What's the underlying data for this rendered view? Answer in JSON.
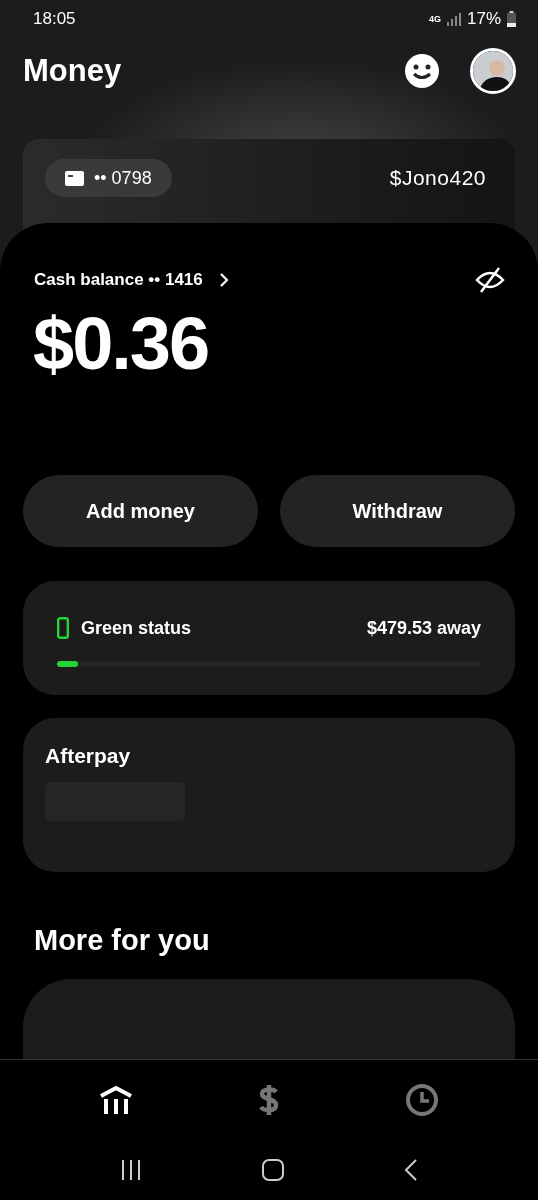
{
  "status_bar": {
    "time": "18:05",
    "network": "4G",
    "battery": "17%"
  },
  "header": {
    "title": "Money"
  },
  "card": {
    "number": "•• 0798",
    "cashtag": "$Jono420"
  },
  "balance": {
    "label": "Cash balance •• 1416",
    "amount": "$0.36",
    "hidden": false
  },
  "actions": [
    "Add money",
    "Withdraw"
  ],
  "green_status": {
    "label": "Green status",
    "reading": "$479.53 away",
    "level": 0.05
  },
  "afterpay": {
    "title": "Afterpay"
  },
  "more": {
    "title": "More for you"
  },
  "nav_tabs": [
    {
      "kind": "bank",
      "selected": true
    },
    {
      "kind": "dollar",
      "selected": false
    },
    {
      "kind": "clock",
      "selected": false
    }
  ]
}
